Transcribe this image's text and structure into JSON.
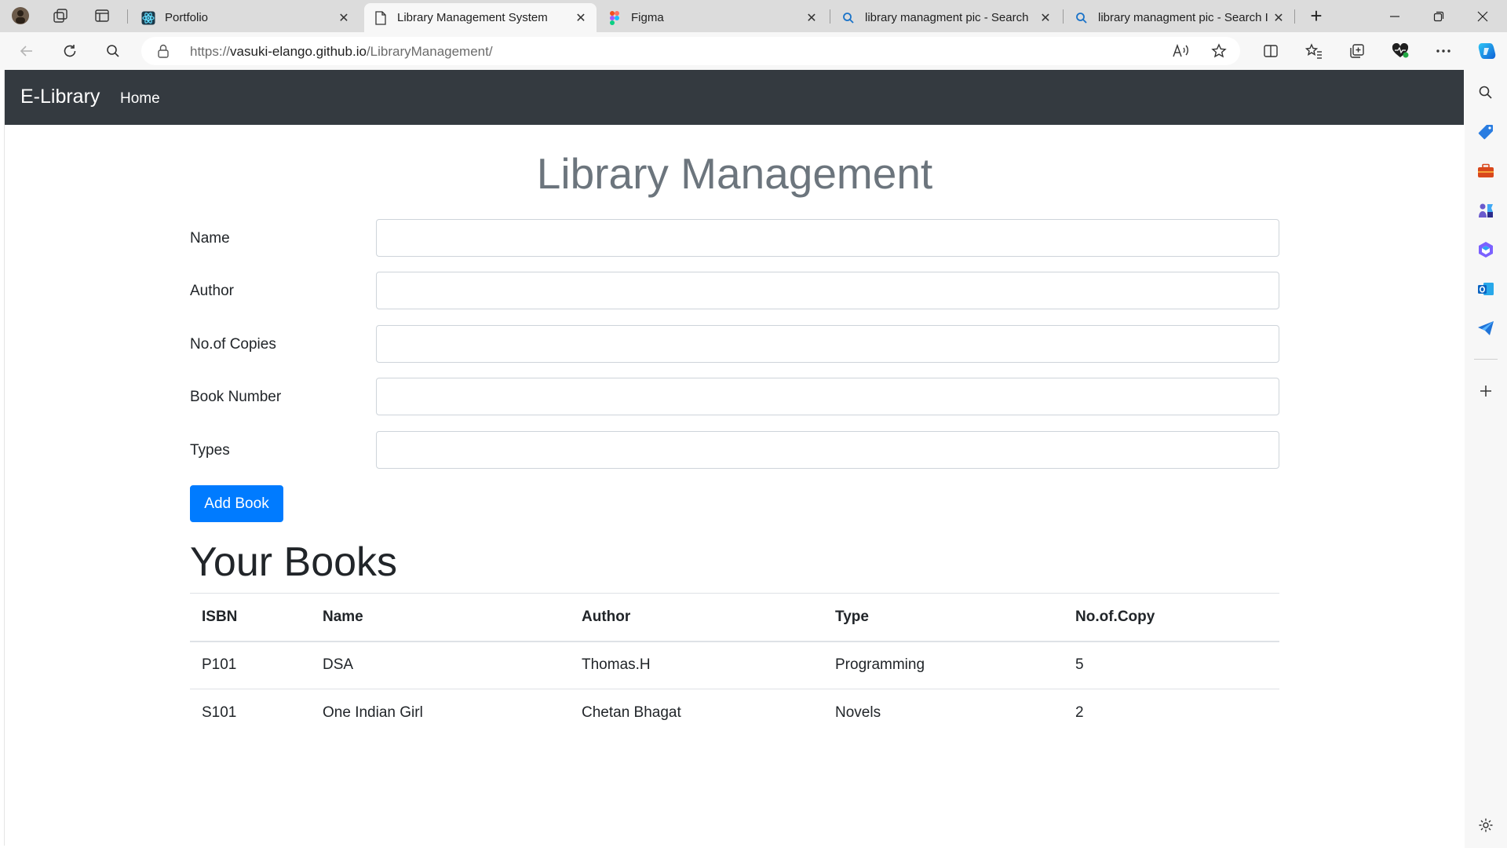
{
  "browser": {
    "tabs": [
      {
        "title": "Portfolio",
        "icon": "react-icon",
        "active": false
      },
      {
        "title": "Library Management System",
        "icon": "page-icon",
        "active": true
      },
      {
        "title": "Figma",
        "icon": "figma-icon",
        "active": false
      },
      {
        "title": "library managment pic - Search",
        "icon": "search-icon",
        "active": false
      },
      {
        "title": "library managment pic - Search I",
        "icon": "search-icon",
        "active": false
      }
    ],
    "close_glyph": "✕",
    "new_tab_glyph": "+",
    "url_scheme": "https://",
    "url_host": "vasuki-elango.github.io",
    "url_path": "/LibraryManagement/"
  },
  "navbar": {
    "brand": "E-Library",
    "home_link": "Home"
  },
  "page": {
    "title": "Library Management",
    "form": {
      "name_label": "Name",
      "name_value": "",
      "author_label": "Author",
      "author_value": "",
      "copies_label": "No.of Copies",
      "copies_value": "",
      "book_number_label": "Book Number",
      "book_number_value": "",
      "types_label": "Types",
      "types_value": ""
    },
    "add_button": "Add Book",
    "books_heading": "Your Books",
    "table": {
      "columns": [
        "ISBN",
        "Name",
        "Author",
        "Type",
        "No.of.Copy"
      ],
      "rows": [
        [
          "P101",
          "DSA",
          "Thomas.H",
          "Programming",
          "5"
        ],
        [
          "S101",
          "One Indian Girl",
          "Chetan Bhagat",
          "Novels",
          "2"
        ]
      ]
    }
  },
  "colors": {
    "navbar_bg": "#343a40",
    "primary_button": "#007bff",
    "title_gray": "#6c757d"
  }
}
